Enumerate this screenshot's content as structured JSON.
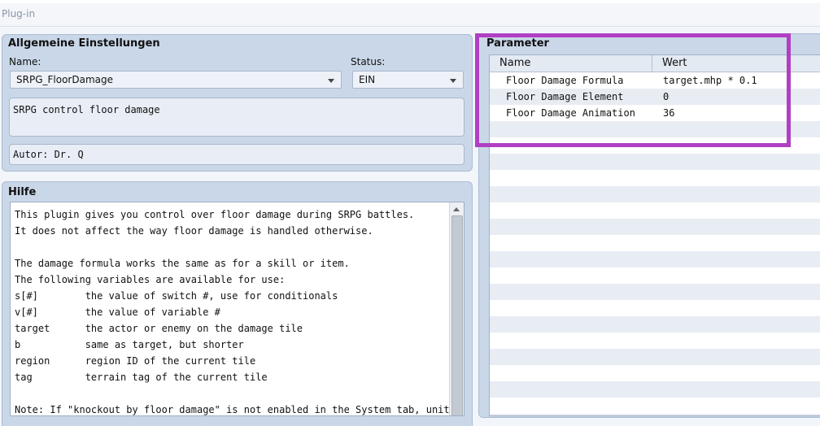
{
  "window": {
    "title": "Plug-in"
  },
  "general": {
    "title": "Allgemeine Einstellungen",
    "name_label": "Name:",
    "name_value": "SRPG_FloorDamage",
    "status_label": "Status:",
    "status_value": "EIN",
    "description": "SRPG control floor damage",
    "author": "Autor: Dr. Q"
  },
  "help": {
    "title": "Hilfe",
    "lines": [
      "This plugin gives you control over floor damage during SRPG battles.",
      "It does not affect the way floor damage is handled otherwise.",
      "",
      "The damage formula works the same as for a skill or item.",
      "The following variables are available for use:",
      "s[#]        the value of switch #, use for conditionals",
      "v[#]        the value of variable #",
      "target      the actor or enemy on the damage tile",
      "b           same as target, but shorter",
      "region      region ID of the current tile",
      "tag         terrain tag of the current tile",
      "",
      "Note: If \"knockout by floor damage\" is not enabled in the System tab, units"
    ]
  },
  "parameters": {
    "title": "Parameter",
    "col_name": "Name",
    "col_value": "Wert",
    "rows": [
      {
        "name": "Floor Damage Formula",
        "value": "target.mhp * 0.1"
      },
      {
        "name": "Floor Damage Element",
        "value": "0"
      },
      {
        "name": "Floor Damage Animation",
        "value": "36"
      }
    ]
  },
  "colors": {
    "highlight": "#b13fc4",
    "panel": "#c9d7e8"
  }
}
